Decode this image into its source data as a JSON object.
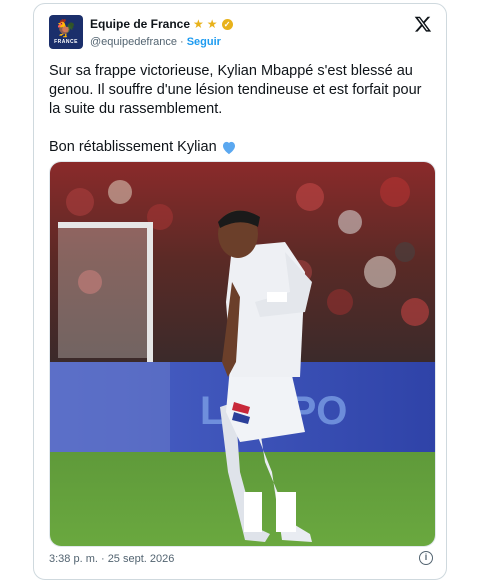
{
  "tweet": {
    "author_name": "Equipe de France",
    "handle": "@equipedefrance",
    "separator": "·",
    "follow_label": "Seguir",
    "text_line_1": "Sur sa frappe victorieuse, Kylian Mbappé s'est blessé au genou. Il souffre d'une lésion tendineuse et est forfait pour la suite du rassemblement.",
    "text_line_2": "Bon rétablissement Kylian",
    "timestamp": "3:38 p. m. · 25 sept. 2026",
    "info_glyph": "i"
  },
  "avatar": {
    "glyph": "🐓",
    "wordmark": "FRANCE"
  },
  "badges": [
    "star-icon",
    "star-icon",
    "verified-icon"
  ],
  "colors": {
    "link": "#1d9bf0",
    "gold": "#e8b21b",
    "heart": "#5ba8f0",
    "avatar_bg": "#1b2f6b"
  },
  "media": {
    "ad_board_text": "LA SPO"
  }
}
